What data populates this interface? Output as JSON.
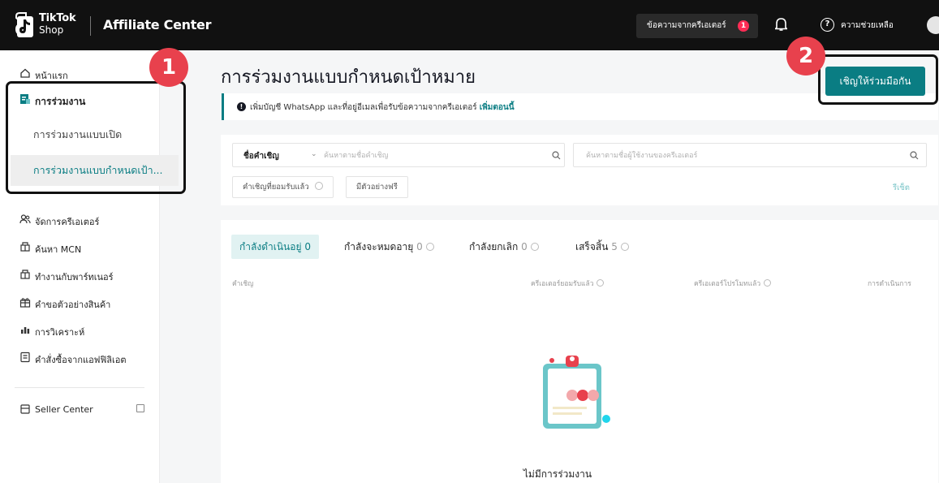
{
  "header": {
    "logo_line1": "TikTok",
    "logo_line2": "Shop",
    "app_title": "Affiliate Center",
    "messages_label": "ข้อความจากครีเอเตอร์",
    "messages_badge": "1",
    "help_label": "ความช่วยเหลือ"
  },
  "sidebar": {
    "home": "หน้าแรก",
    "collab": "การร่วมงาน",
    "open_collab": "การร่วมงานแบบเปิด",
    "targeted_collab": "การร่วมงานแบบกำหนดเป้า...",
    "manage_creators": "จัดการครีเอเตอร์",
    "find_mcn": "ค้นหา MCN",
    "partners": "ทำงานกับพาร์ทเนอร์",
    "sample_requests": "คำขอตัวอย่างสินค้า",
    "analytics": "การวิเคราะห์",
    "affiliate_orders": "คำสั่งซื้อจากแอฟฟิลิเอต",
    "seller_center": "Seller Center"
  },
  "annotations": {
    "one": "1",
    "two": "2"
  },
  "main": {
    "title": "การร่วมงานแบบกำหนดเป้าหมาย",
    "invite_button": "เชิญให้ร่วมมือกัน",
    "notice_text": "เพิ่มบัญชี WhatsApp และที่อยู่อีเมลเพื่อรับข้อความจากครีเอเตอร์",
    "notice_link": "เพิ่มตอนนี้",
    "filter": {
      "select_label": "ชื่อคำเชิญ",
      "search1_placeholder": "ค้นหาตามชื่อคำเชิญ",
      "search2_placeholder": "ค้นหาตามชื่อผู้ใช้งานของครีเอเตอร์",
      "chip_accepted": "คำเชิญที่ยอมรับแล้ว",
      "chip_free_sample": "มีตัวอย่างฟรี",
      "reset": "รีเซ็ต"
    },
    "tabs": [
      {
        "label": "กำลังดำเนินอยู่",
        "count": "0"
      },
      {
        "label": "กำลังจะหมดอายุ",
        "count": "0"
      },
      {
        "label": "กำลังยกเลิก",
        "count": "0"
      },
      {
        "label": "เสร็จสิ้น",
        "count": "5"
      }
    ],
    "columns": [
      "คำเชิญ",
      "ครีเอเตอร์ยอมรับแล้ว",
      "ครีเอเตอร์โปรโมทแล้ว",
      "การดำเนินการ"
    ],
    "empty_text": "ไม่มีการร่วมงาน"
  },
  "colors": {
    "accent": "#0a7d83",
    "annotation": "#e8414d",
    "badge": "#fe2c55"
  }
}
